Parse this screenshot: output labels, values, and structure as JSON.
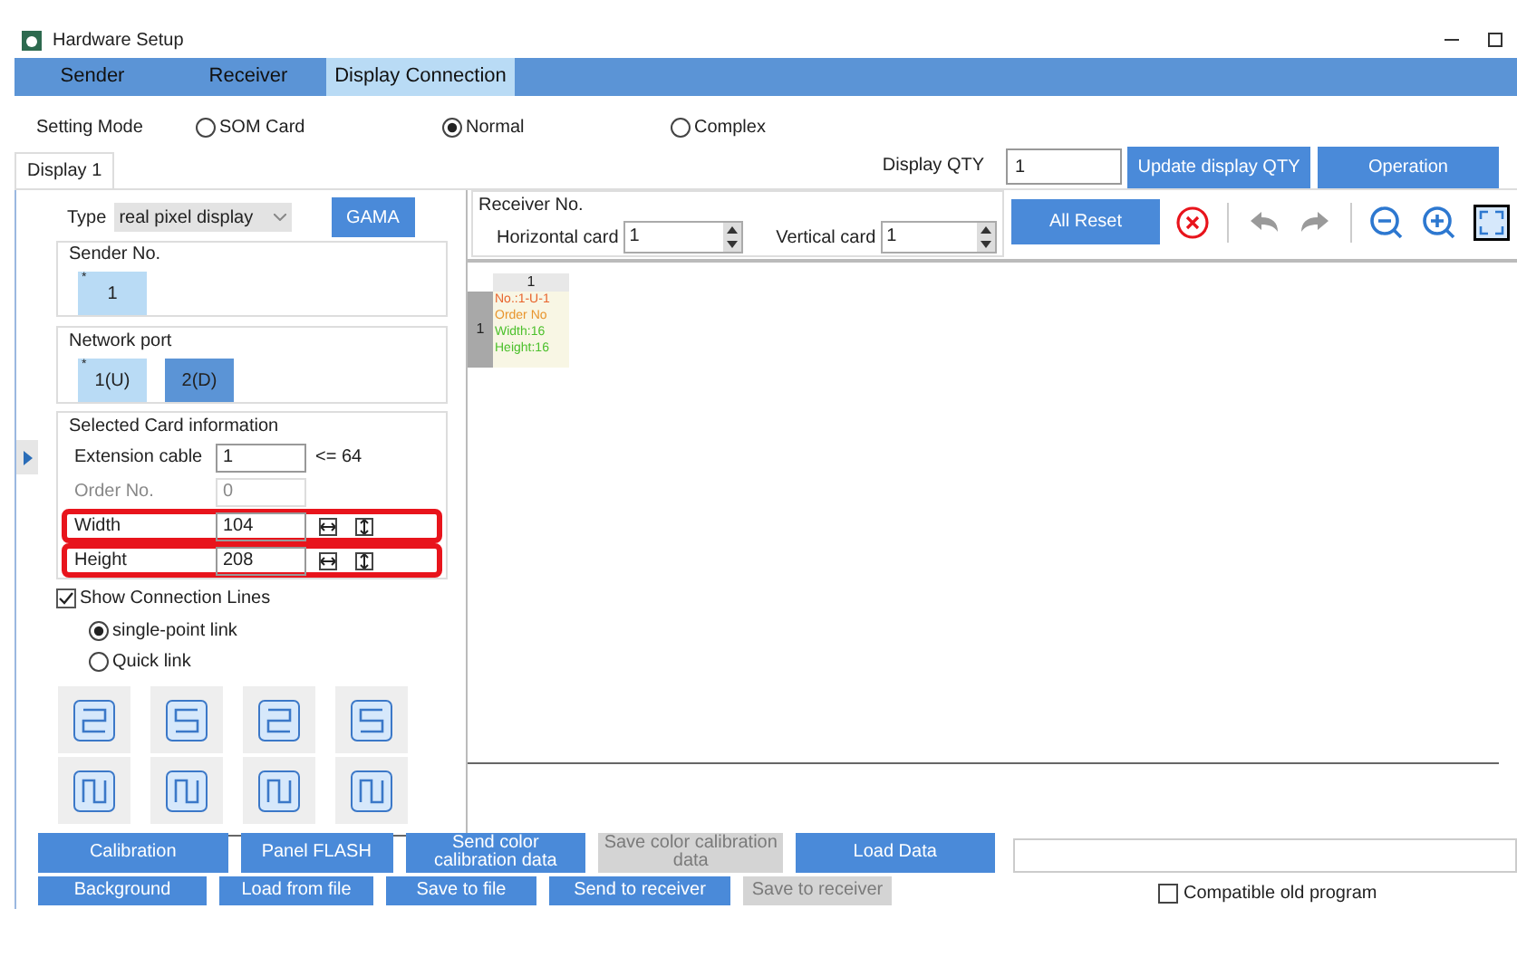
{
  "window": {
    "title": "Hardware Setup"
  },
  "tabs": [
    {
      "label": "Sender",
      "selected": false
    },
    {
      "label": "Receiver",
      "selected": false
    },
    {
      "label": "Display Connection",
      "selected": true
    }
  ],
  "setting_mode": {
    "label": "Setting Mode",
    "options": [
      {
        "label": "SOM Card",
        "selected": false
      },
      {
        "label": "Normal",
        "selected": true
      },
      {
        "label": "Complex",
        "selected": false
      }
    ]
  },
  "display_tabs": [
    {
      "label": "Display 1",
      "selected": true
    }
  ],
  "display_qty": {
    "label": "Display QTY",
    "value": "1"
  },
  "top_buttons": [
    "Update display QTY",
    "Operation"
  ],
  "type": {
    "label": "Type",
    "value": "real pixel display"
  },
  "gama_button": "GAMA",
  "sender_no": {
    "title": "Sender No.",
    "items": [
      {
        "label": "1",
        "mark": "*",
        "selected": false
      }
    ]
  },
  "network_port": {
    "title": "Network port",
    "items": [
      {
        "label": "1(U)",
        "mark": "*",
        "selected": false
      },
      {
        "label": "2(D)",
        "selected": true
      }
    ]
  },
  "card_info": {
    "title": "Selected Card information",
    "fields": [
      {
        "kind": "limit",
        "label": "Extension cable",
        "value": "1",
        "hint": "<= 64",
        "disabled": false,
        "highlighted": false
      },
      {
        "kind": "plain",
        "label": "Order No.",
        "value": "0",
        "disabled": true,
        "highlighted": false
      },
      {
        "kind": "size",
        "label": "Width",
        "value": "104",
        "disabled": false,
        "highlighted": true
      },
      {
        "kind": "size",
        "label": "Height",
        "value": "208",
        "disabled": false,
        "highlighted": true
      }
    ]
  },
  "show_lines": {
    "label": "Show Connection Lines",
    "checked": true
  },
  "link_modes": [
    {
      "label": "single-point link",
      "selected": true
    },
    {
      "label": "Quick link",
      "selected": false
    }
  ],
  "receiver_no": {
    "title": "Receiver No.",
    "horizontal": {
      "label": "Horizontal card",
      "value": "1"
    },
    "vertical": {
      "label": "Vertical card",
      "value": "1"
    }
  },
  "all_reset": "All Reset",
  "toolbar": [
    {
      "kind": "delete",
      "disabled": false
    },
    {
      "kind": "undo",
      "disabled": true
    },
    {
      "kind": "redo",
      "disabled": true
    },
    {
      "kind": "zoom_out",
      "disabled": false
    },
    {
      "kind": "zoom_in",
      "disabled": false
    },
    {
      "kind": "fit",
      "disabled": false
    }
  ],
  "canvas": {
    "column_header": "1",
    "row_header": "1",
    "card_lines": [
      {
        "text": "No.:1-U-1",
        "color": "#e8642c"
      },
      {
        "text": "Order No",
        "color": "#e8942c"
      },
      {
        "text": "Width:16",
        "color": "#4cc02c"
      },
      {
        "text": "Height:16",
        "color": "#4cc02c"
      }
    ]
  },
  "bottom_rows": [
    [
      {
        "label": "Calibration",
        "disabled": false
      },
      {
        "label": "Panel FLASH",
        "disabled": false
      },
      {
        "label": "Send color calibration data",
        "disabled": false
      },
      {
        "label": "Save color calibration data",
        "disabled": true
      },
      {
        "label": "Load Data",
        "disabled": false
      }
    ],
    [
      {
        "label": "Background",
        "disabled": false
      },
      {
        "label": "Load from file",
        "disabled": false
      },
      {
        "label": "Save to file",
        "disabled": false
      },
      {
        "label": "Send to receiver",
        "disabled": false
      },
      {
        "label": "Save to receiver",
        "disabled": true
      }
    ]
  ],
  "compatible": {
    "label": "Compatible old program",
    "checked": false
  }
}
